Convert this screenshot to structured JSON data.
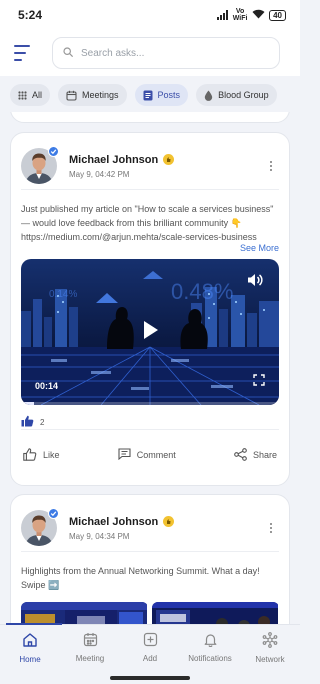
{
  "status_bar": {
    "time": "5:24",
    "network": "Vo WiFi",
    "battery": "40"
  },
  "search": {
    "placeholder": "Search asks..."
  },
  "filters": [
    {
      "label": "All",
      "icon": "grid-icon"
    },
    {
      "label": "Meetings",
      "icon": "calendar-icon"
    },
    {
      "label": "Posts",
      "icon": "document-icon",
      "active": true
    },
    {
      "label": "Blood Group",
      "icon": "blood-drop-icon"
    }
  ],
  "posts": [
    {
      "author": "Michael Johnson",
      "timestamp": "May 9, 04:42 PM",
      "text": "Just published my article on \"How to scale a services business\" — would love feedback from this brilliant community 👇 https://medium.com/@arjun.mehta/scale-services-business",
      "see_more": "See More",
      "video_time": "00:14",
      "video_progress": 0.05,
      "likes_count": "2",
      "actions": {
        "like": "Like",
        "comment": "Comment",
        "share": "Share"
      }
    },
    {
      "author": "Michael Johnson",
      "timestamp": "May 9, 04:34 PM",
      "text": "Highlights from the Annual Networking Summit. What a day! Swipe ➡️"
    }
  ],
  "nav": [
    {
      "label": "Home",
      "icon": "home-icon",
      "active": true
    },
    {
      "label": "Meeting",
      "icon": "calendar-icon"
    },
    {
      "label": "Add",
      "icon": "plus-square-icon"
    },
    {
      "label": "Notifications",
      "icon": "bell-icon"
    },
    {
      "label": "Network",
      "icon": "network-icon"
    }
  ],
  "colors": {
    "accent": "#3b4ea8",
    "verified": "#3d7be5",
    "badge": "#f2c230"
  }
}
